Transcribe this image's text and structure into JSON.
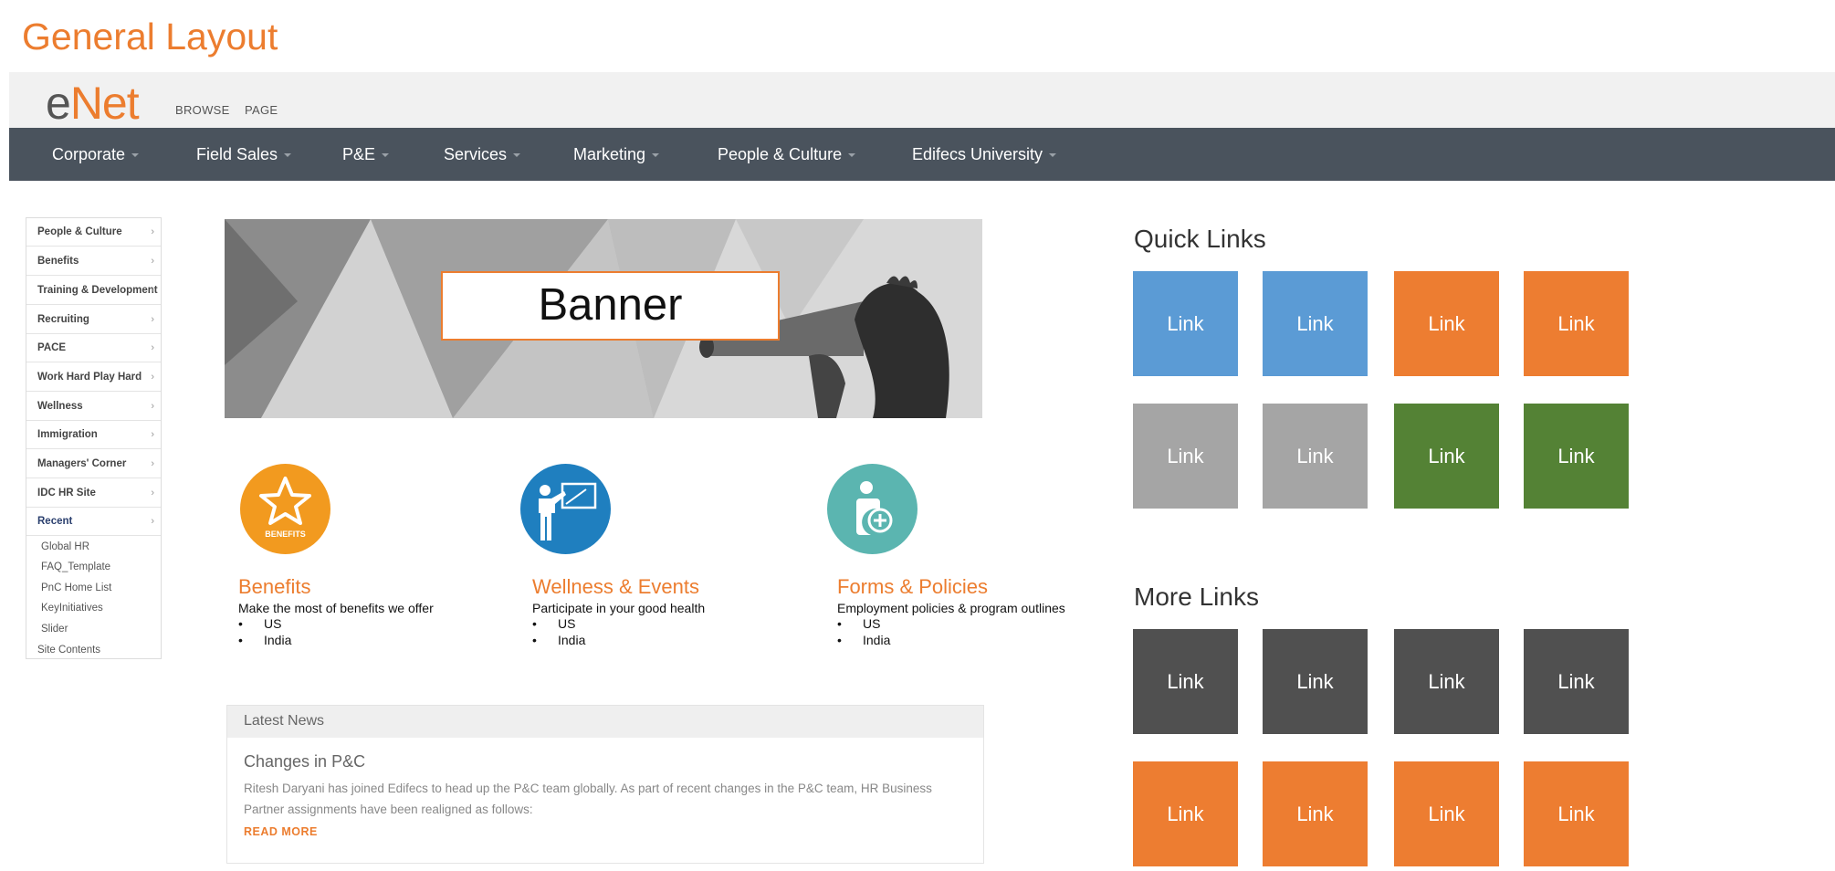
{
  "page": {
    "title": "General Layout"
  },
  "header": {
    "logo_e": "e",
    "logo_net": "Net",
    "top_links": [
      "BROWSE",
      "PAGE"
    ]
  },
  "nav": {
    "items": [
      "Corporate",
      "Field Sales",
      "P&E",
      "Services",
      "Marketing",
      "People & Culture",
      "Edifecs University"
    ]
  },
  "sidebar": {
    "items": [
      "People & Culture",
      "Benefits",
      "Training & Development",
      "Recruiting",
      "PACE",
      "Work Hard Play Hard",
      "Wellness",
      "Immigration",
      "Managers' Corner",
      "IDC HR Site",
      "Recent"
    ],
    "recent_items": [
      "Global HR",
      "FAQ_Template",
      "PnC Home List",
      "KeyInitiatives",
      "Slider"
    ],
    "footer_link": "Site Contents"
  },
  "banner": {
    "label": "Banner"
  },
  "features": [
    {
      "icon": "star-icon",
      "icon_caption": "BENEFITS",
      "color": "#f29a1f",
      "title": "Benefits",
      "description": "Make the most of benefits we offer",
      "bullets": [
        "US",
        "India"
      ]
    },
    {
      "icon": "presenter-icon",
      "icon_caption": "",
      "color": "#1f7fbf",
      "title": "Wellness & Events",
      "description": "Participate in your good health",
      "bullets": [
        "US",
        "India"
      ]
    },
    {
      "icon": "person-plus-icon",
      "icon_caption": "",
      "color": "#5bb5b0",
      "title": "Forms & Policies",
      "description": "Employment policies & program outlines",
      "bullets": [
        "US",
        "India"
      ]
    }
  ],
  "news": {
    "header": "Latest News",
    "title": "Changes in P&C",
    "body": "Ritesh Daryani has joined Edifecs to head up the P&C team globally. As part of recent changes in the P&C team, HR Business Partner assignments have been realigned as follows:",
    "read_more": "READ MORE"
  },
  "quick_links": {
    "title": "Quick Links",
    "tiles": [
      {
        "label": "Link",
        "color": "#5b9bd5"
      },
      {
        "label": "Link",
        "color": "#5b9bd5"
      },
      {
        "label": "Link",
        "color": "#ed7d31"
      },
      {
        "label": "Link",
        "color": "#ed7d31"
      },
      {
        "label": "Link",
        "color": "#a5a5a5"
      },
      {
        "label": "Link",
        "color": "#a5a5a5"
      },
      {
        "label": "Link",
        "color": "#548235"
      },
      {
        "label": "Link",
        "color": "#548235"
      }
    ]
  },
  "more_links": {
    "title": "More Links",
    "tiles": [
      {
        "label": "Link",
        "color": "#505050"
      },
      {
        "label": "Link",
        "color": "#505050"
      },
      {
        "label": "Link",
        "color": "#505050"
      },
      {
        "label": "Link",
        "color": "#505050"
      },
      {
        "label": "Link",
        "color": "#ed7d31"
      },
      {
        "label": "Link",
        "color": "#ed7d31"
      },
      {
        "label": "Link",
        "color": "#ed7d31"
      },
      {
        "label": "Link",
        "color": "#ed7d31"
      }
    ]
  }
}
